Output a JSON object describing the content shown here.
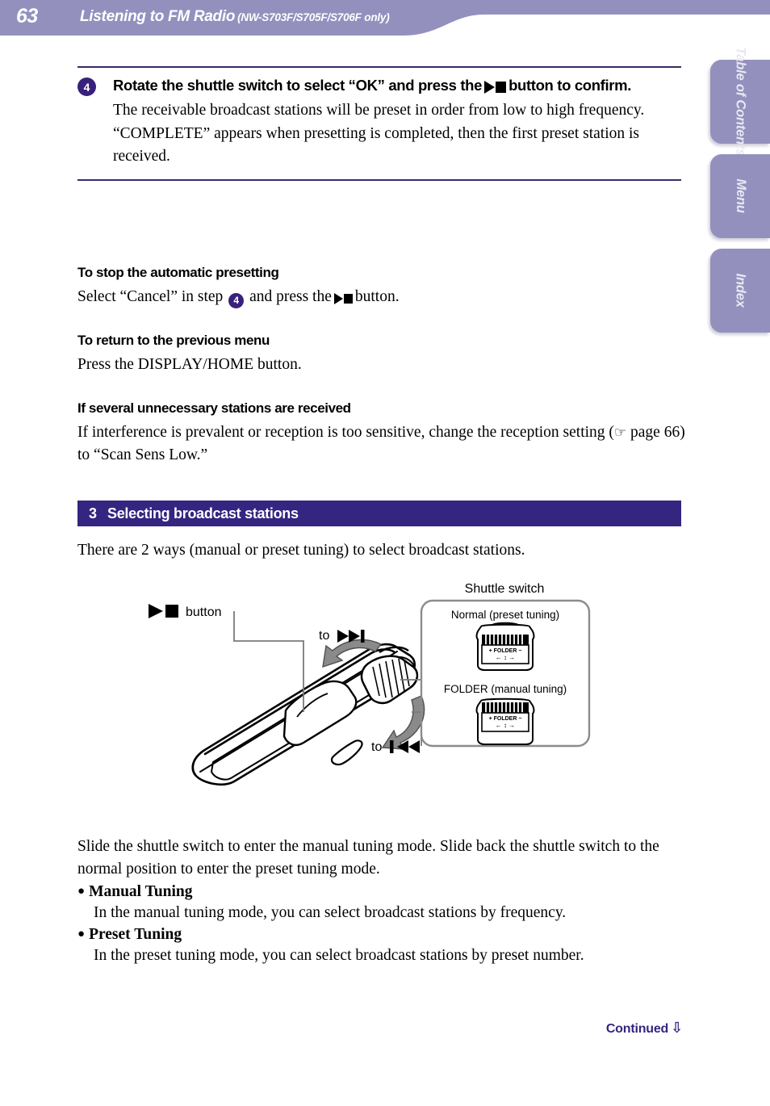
{
  "header": {
    "page_number": "63",
    "title": "Listening to FM Radio",
    "subtitle": "(NW-S703F/S705F/S706F only)",
    "bar_color": "#9490be"
  },
  "side_tabs": [
    {
      "label": "Table of Contents",
      "name": "table-of-contents"
    },
    {
      "label": "Menu",
      "name": "menu"
    },
    {
      "label": "Index",
      "name": "index"
    }
  ],
  "step": {
    "number": "4",
    "title_part1": "Rotate the shuttle switch to select “OK” and press the",
    "title_part2": "button to confirm.",
    "desc_line1": "The receivable broadcast stations will be preset in order from low to high frequency.",
    "desc_line2": "“COMPLETE” appears when presetting is completed, then the first preset station is received."
  },
  "subsections": [
    {
      "heading": "To stop the automatic presetting",
      "text_a": "Select “Cancel” in step",
      "badge": "4",
      "text_b": "and press the",
      "text_c": "button."
    },
    {
      "heading": "To return to the previous menu",
      "text": "Press the DISPLAY/HOME button."
    },
    {
      "heading": "If several unnecessary stations are received",
      "text_a": "If interference is prevalent or reception is too sensitive, change the reception setting (",
      "hand_icon": "☞",
      "text_b": "page 66) to “Scan Sens Low.”"
    }
  ],
  "section": {
    "number": "3",
    "title": "Selecting broadcast stations",
    "intro": "There are 2 ways (manual or preset tuning) to select broadcast stations.",
    "bar_color": "#342580"
  },
  "diagram": {
    "callout_title": "Shuttle switch",
    "label_button": "button",
    "label_to_next": "to",
    "label_to_prev": "to",
    "mode_normal": "Normal (preset tuning)",
    "mode_folder": "FOLDER (manual tuning)",
    "display_text": "+ FOLDER −"
  },
  "body": {
    "para1": "Slide the shuttle switch to enter the manual tuning mode. Slide back the shuttle switch to the normal position to enter the preset tuning mode.",
    "bullets": [
      {
        "title": "Manual Tuning",
        "text": "In the manual tuning mode, you can select broadcast stations by frequency."
      },
      {
        "title": "Preset Tuning",
        "text": "In the preset tuning mode, you can select broadcast stations by preset number."
      }
    ]
  },
  "footer": {
    "continued": "Continued",
    "arrow": "⇩"
  }
}
